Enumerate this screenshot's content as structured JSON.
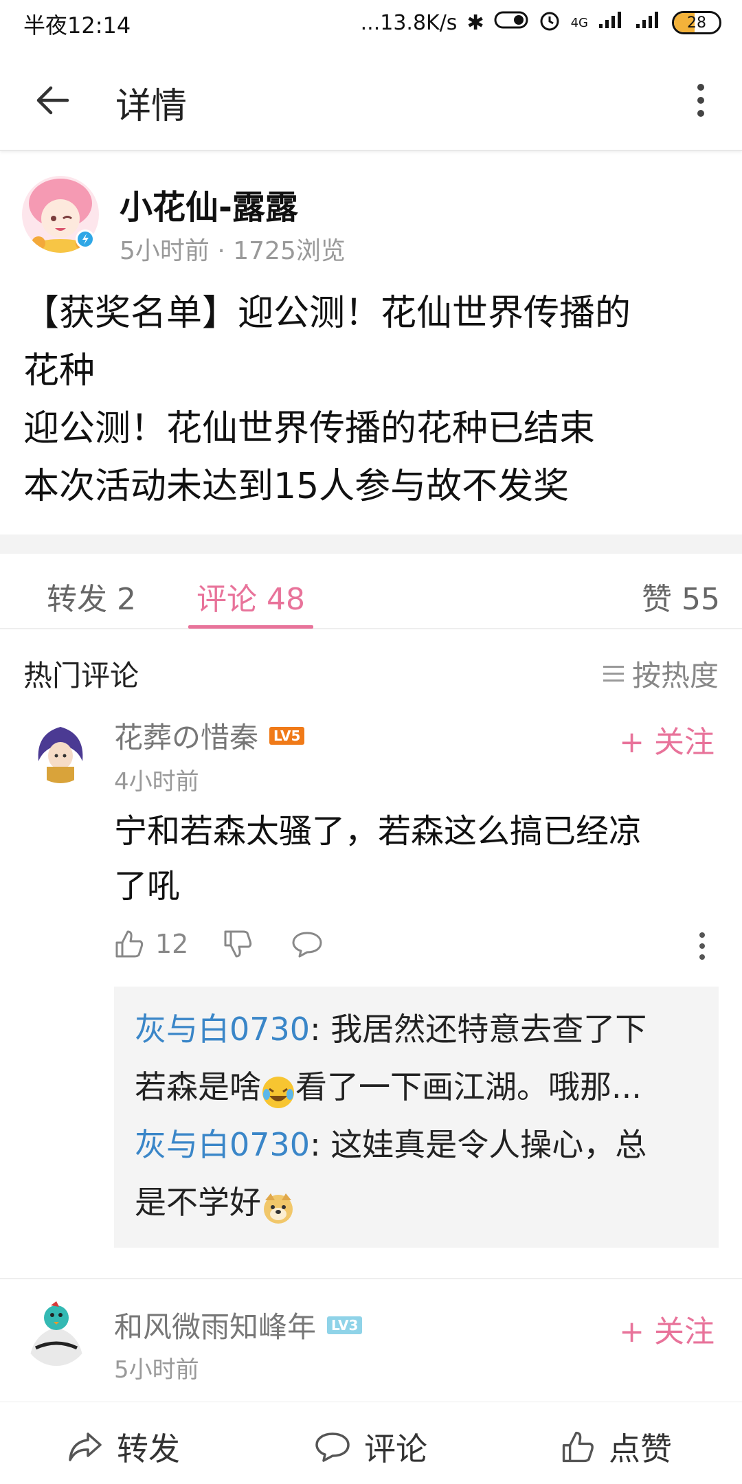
{
  "status_bar": {
    "time": "半夜12:14",
    "network_speed": "...13.8K/s",
    "signal": "4G",
    "battery": "28"
  },
  "header": {
    "title": "详情"
  },
  "post": {
    "author": "小花仙-露露",
    "meta": "5小时前 · 1725浏览",
    "lines": [
      "【获奖名单】迎公测！花仙世界传播的",
      "花种",
      "迎公测！花仙世界传播的花种已结束",
      "本次活动未达到15人参与故不发奖"
    ]
  },
  "tabs": {
    "repost": "转发 2",
    "comment": "评论 48",
    "like": "赞 55"
  },
  "comments_section": {
    "title": "热门评论",
    "sort_label": "按热度"
  },
  "comments": [
    {
      "user": "花葬の惜秦",
      "level": "LV5",
      "follow_label": "+ 关注",
      "time": "4小时前",
      "text_lines": [
        "宁和若森太骚了，若森这么搞已经凉",
        "了吼"
      ],
      "likes": "12",
      "replies": [
        {
          "name": "灰与白0730",
          "line1": ": 我居然还特意去查了下",
          "line2a": "若森是啥",
          "line2b": "看了一下画江湖。哦那..."
        },
        {
          "name": "灰与白0730",
          "line1": ": 这娃真是令人操心，总",
          "line2a": "是不学好",
          "line2b": ""
        }
      ]
    },
    {
      "user": "和风微雨知峰年",
      "level": "LV3",
      "follow_label": "+ 关注",
      "time": "5小时前"
    }
  ],
  "bottom_bar": {
    "repost": "转发",
    "comment": "评论",
    "like": "点赞"
  },
  "colors": {
    "accent": "#e8739a",
    "link": "#3a86c8"
  }
}
